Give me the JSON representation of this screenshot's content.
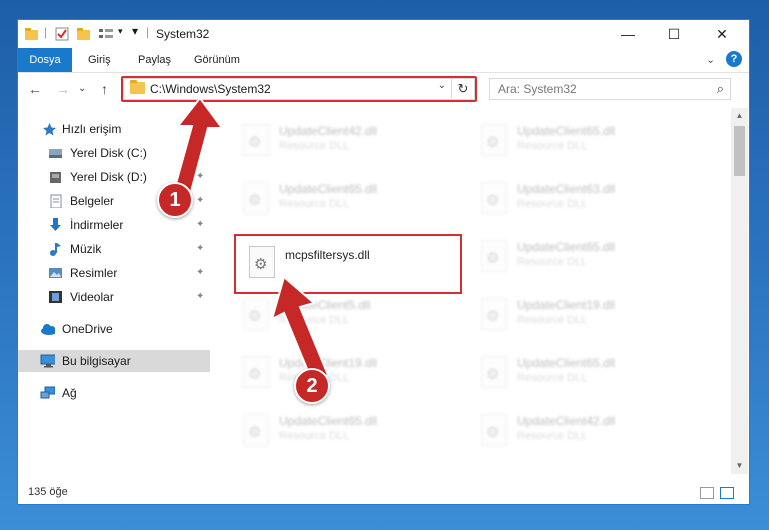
{
  "window": {
    "title": "System32",
    "controls": {
      "minimize": "—",
      "maximize": "☐",
      "close": "✕"
    }
  },
  "ribbon": {
    "tabs": [
      {
        "label": "Dosya",
        "active": true
      },
      {
        "label": "Giriş",
        "active": false
      },
      {
        "label": "Paylaş",
        "active": false
      },
      {
        "label": "Görünüm",
        "active": false
      }
    ],
    "expand": "⌄",
    "help": "?"
  },
  "nav": {
    "back": "←",
    "forward": "→",
    "recent": "⌄",
    "up": "↑",
    "address": "C:\\Windows\\System32",
    "address_dropdown": "⌄",
    "refresh": "↻",
    "search_placeholder": "Ara: System32",
    "search_icon": "⌕"
  },
  "sidebar": {
    "items": [
      {
        "label": "Hızlı erişim",
        "icon": "star-icon",
        "pinned": false
      },
      {
        "label": "Yerel Disk (C:)",
        "icon": "drive-icon",
        "pinned": true
      },
      {
        "label": "Yerel Disk (D:)",
        "icon": "drive-icon",
        "pinned": true
      },
      {
        "label": "Belgeler",
        "icon": "documents-icon",
        "pinned": true
      },
      {
        "label": "İndirmeler",
        "icon": "download-icon",
        "pinned": true
      },
      {
        "label": "Müzik",
        "icon": "music-icon",
        "pinned": true
      },
      {
        "label": "Resimler",
        "icon": "pictures-icon",
        "pinned": true
      },
      {
        "label": "Videolar",
        "icon": "videos-icon",
        "pinned": true
      },
      {
        "label": "OneDrive",
        "icon": "cloud-icon",
        "pinned": false
      },
      {
        "label": "Bu bilgisayar",
        "icon": "computer-icon",
        "pinned": false,
        "selected": true
      },
      {
        "label": "Ağ",
        "icon": "network-icon",
        "pinned": false
      }
    ],
    "pin_glyph": "📌"
  },
  "files": {
    "type_label": "Resource DLL",
    "items": [
      {
        "name": "UpdateClient42.dll",
        "blurred": true
      },
      {
        "name": "UpdateClient65.dll",
        "blurred": true
      },
      {
        "name": "UpdateClient65.dll",
        "blurred": true
      },
      {
        "name": "UpdateClient63.dll",
        "blurred": true
      },
      {
        "name": "mcpsfiltersys.dll",
        "blurred": false
      },
      {
        "name": "UpdateClient65.dll",
        "blurred": true
      },
      {
        "name": "UpdateClient5.dll",
        "blurred": true
      },
      {
        "name": "UpdateClient19.dll",
        "blurred": true
      },
      {
        "name": "UpdateClient19.dll",
        "blurred": true
      },
      {
        "name": "UpdateClient65.dll",
        "blurred": true
      },
      {
        "name": "UpdateClient65.dll",
        "blurred": true
      },
      {
        "name": "UpdateClient42.dll",
        "blurred": true
      }
    ]
  },
  "status": {
    "count": "135 öğe"
  },
  "annotations": {
    "step1": "1",
    "step2": "2"
  },
  "colors": {
    "accent": "#1979ca",
    "highlight": "#d32f2f",
    "badge": "#c62828"
  }
}
